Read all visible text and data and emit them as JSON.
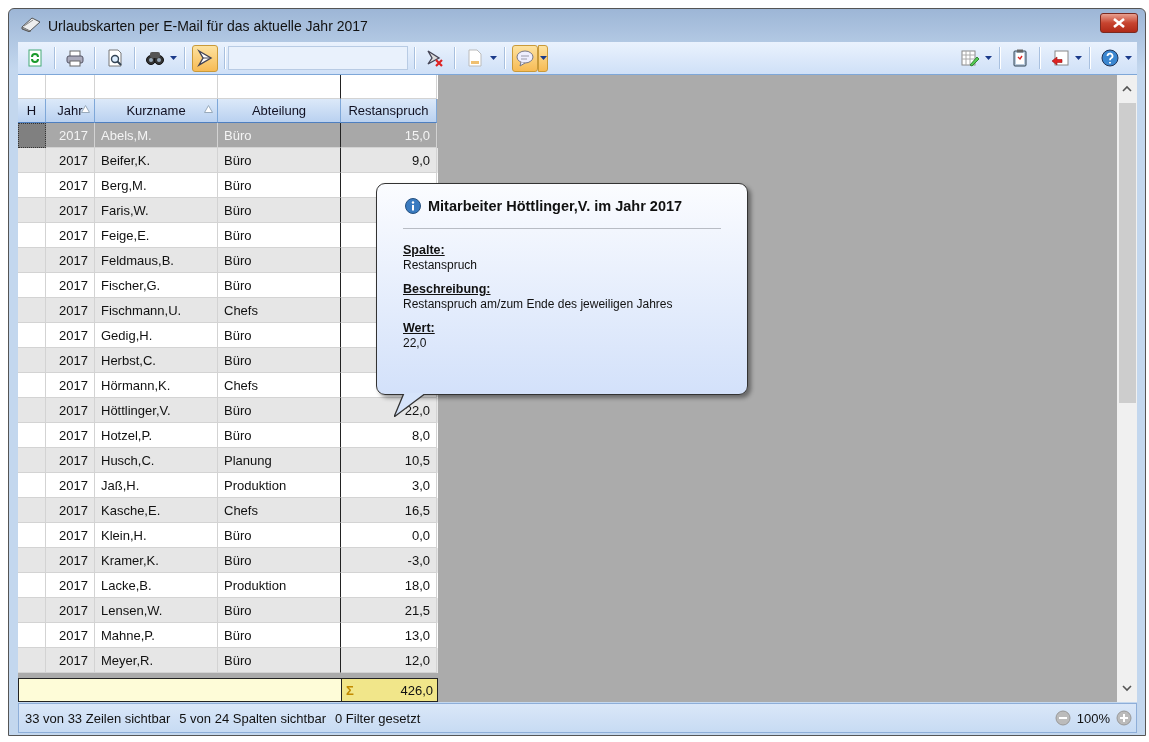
{
  "window": {
    "title": "Urlaubskarten per E-Mail für das aktuelle Jahr 2017"
  },
  "toolbar": {
    "left": [
      {
        "kind": "refresh",
        "pressed": false,
        "dropdown": false
      },
      {
        "kind": "printer",
        "pressed": false,
        "dropdown": false
      },
      {
        "kind": "preview",
        "pressed": false,
        "dropdown": false
      },
      {
        "kind": "binoculars",
        "pressed": false,
        "dropdown": true
      },
      {
        "kind": "filter",
        "pressed": true,
        "dropdown": false
      },
      {
        "kind": "field"
      },
      {
        "kind": "filter-clear",
        "pressed": false,
        "dropdown": false
      },
      {
        "kind": "document",
        "pressed": false,
        "dropdown": true
      },
      {
        "kind": "bubble",
        "pressed": true,
        "dropdown": true
      }
    ],
    "right": [
      {
        "kind": "grid-edit",
        "pressed": false,
        "dropdown": true
      },
      {
        "kind": "clipboard",
        "pressed": false,
        "dropdown": false
      },
      {
        "kind": "window-arrow",
        "pressed": false,
        "dropdown": true
      },
      {
        "kind": "help",
        "pressed": false,
        "dropdown": true
      }
    ]
  },
  "table": {
    "columns": [
      {
        "label": "H",
        "sorted": false
      },
      {
        "label": "Jahr",
        "sorted": true
      },
      {
        "label": "Kurzname",
        "sorted": true
      },
      {
        "label": "Abteilung",
        "sorted": false
      },
      {
        "label": "Restanspruch",
        "sorted": false
      }
    ],
    "rows": [
      {
        "jahr": "2017",
        "kurzname": "Abels,M.",
        "abteilung": "Büro",
        "restanspruch": "15,0",
        "selected": true
      },
      {
        "jahr": "2017",
        "kurzname": "Beifer,K.",
        "abteilung": "Büro",
        "restanspruch": "9,0",
        "selected": false
      },
      {
        "jahr": "2017",
        "kurzname": "Berg,M.",
        "abteilung": "Büro",
        "selected": false
      },
      {
        "jahr": "2017",
        "kurzname": "Faris,W.",
        "abteilung": "Büro",
        "selected": false
      },
      {
        "jahr": "2017",
        "kurzname": "Feige,E.",
        "abteilung": "Büro",
        "selected": false
      },
      {
        "jahr": "2017",
        "kurzname": "Feldmaus,B.",
        "abteilung": "Büro",
        "selected": false
      },
      {
        "jahr": "2017",
        "kurzname": "Fischer,G.",
        "abteilung": "Büro",
        "selected": false
      },
      {
        "jahr": "2017",
        "kurzname": "Fischmann,U.",
        "abteilung": "Chefs",
        "selected": false
      },
      {
        "jahr": "2017",
        "kurzname": "Gedig,H.",
        "abteilung": "Büro",
        "selected": false
      },
      {
        "jahr": "2017",
        "kurzname": "Herbst,C.",
        "abteilung": "Büro",
        "selected": false
      },
      {
        "jahr": "2017",
        "kurzname": "Hörmann,K.",
        "abteilung": "Chefs",
        "selected": false
      },
      {
        "jahr": "2017",
        "kurzname": "Höttlinger,V.",
        "abteilung": "Büro",
        "restanspruch": "22,0",
        "selected": false
      },
      {
        "jahr": "2017",
        "kurzname": "Hotzel,P.",
        "abteilung": "Büro",
        "restanspruch": "8,0",
        "selected": false
      },
      {
        "jahr": "2017",
        "kurzname": "Husch,C.",
        "abteilung": "Planung",
        "restanspruch": "10,5",
        "selected": false
      },
      {
        "jahr": "2017",
        "kurzname": "Jaß,H.",
        "abteilung": "Produktion",
        "restanspruch": "3,0",
        "selected": false
      },
      {
        "jahr": "2017",
        "kurzname": "Kasche,E.",
        "abteilung": "Chefs",
        "restanspruch": "16,5",
        "selected": false
      },
      {
        "jahr": "2017",
        "kurzname": "Klein,H.",
        "abteilung": "Büro",
        "restanspruch": "0,0",
        "selected": false
      },
      {
        "jahr": "2017",
        "kurzname": "Kramer,K.",
        "abteilung": "Büro",
        "restanspruch": "-3,0",
        "selected": false
      },
      {
        "jahr": "2017",
        "kurzname": "Lacke,B.",
        "abteilung": "Produktion",
        "restanspruch": "18,0",
        "selected": false
      },
      {
        "jahr": "2017",
        "kurzname": "Lensen,W.",
        "abteilung": "Büro",
        "restanspruch": "21,5",
        "selected": false
      },
      {
        "jahr": "2017",
        "kurzname": "Mahne,P.",
        "abteilung": "Büro",
        "restanspruch": "13,0",
        "selected": false
      },
      {
        "jahr": "2017",
        "kurzname": "Meyer,R.",
        "abteilung": "Büro",
        "restanspruch": "12,0",
        "selected": false
      }
    ],
    "footer": {
      "sum_symbol": "Σ",
      "sum": "426,0"
    }
  },
  "tooltip": {
    "title": "Mitarbeiter Höttlinger,V. im Jahr 2017",
    "sections": [
      {
        "heading": "Spalte:",
        "text": "Restanspruch"
      },
      {
        "heading": "Beschreibung:",
        "text": "Restanspruch am/zum Ende des jeweiligen Jahres"
      },
      {
        "heading": "Wert:",
        "text": "22,0"
      }
    ]
  },
  "status_bar": {
    "items": [
      "33 von 33 Zeilen sichtbar",
      "5 von 24 Spalten sichtbar",
      "0 Filter gesetzt"
    ],
    "zoom": "100%"
  }
}
